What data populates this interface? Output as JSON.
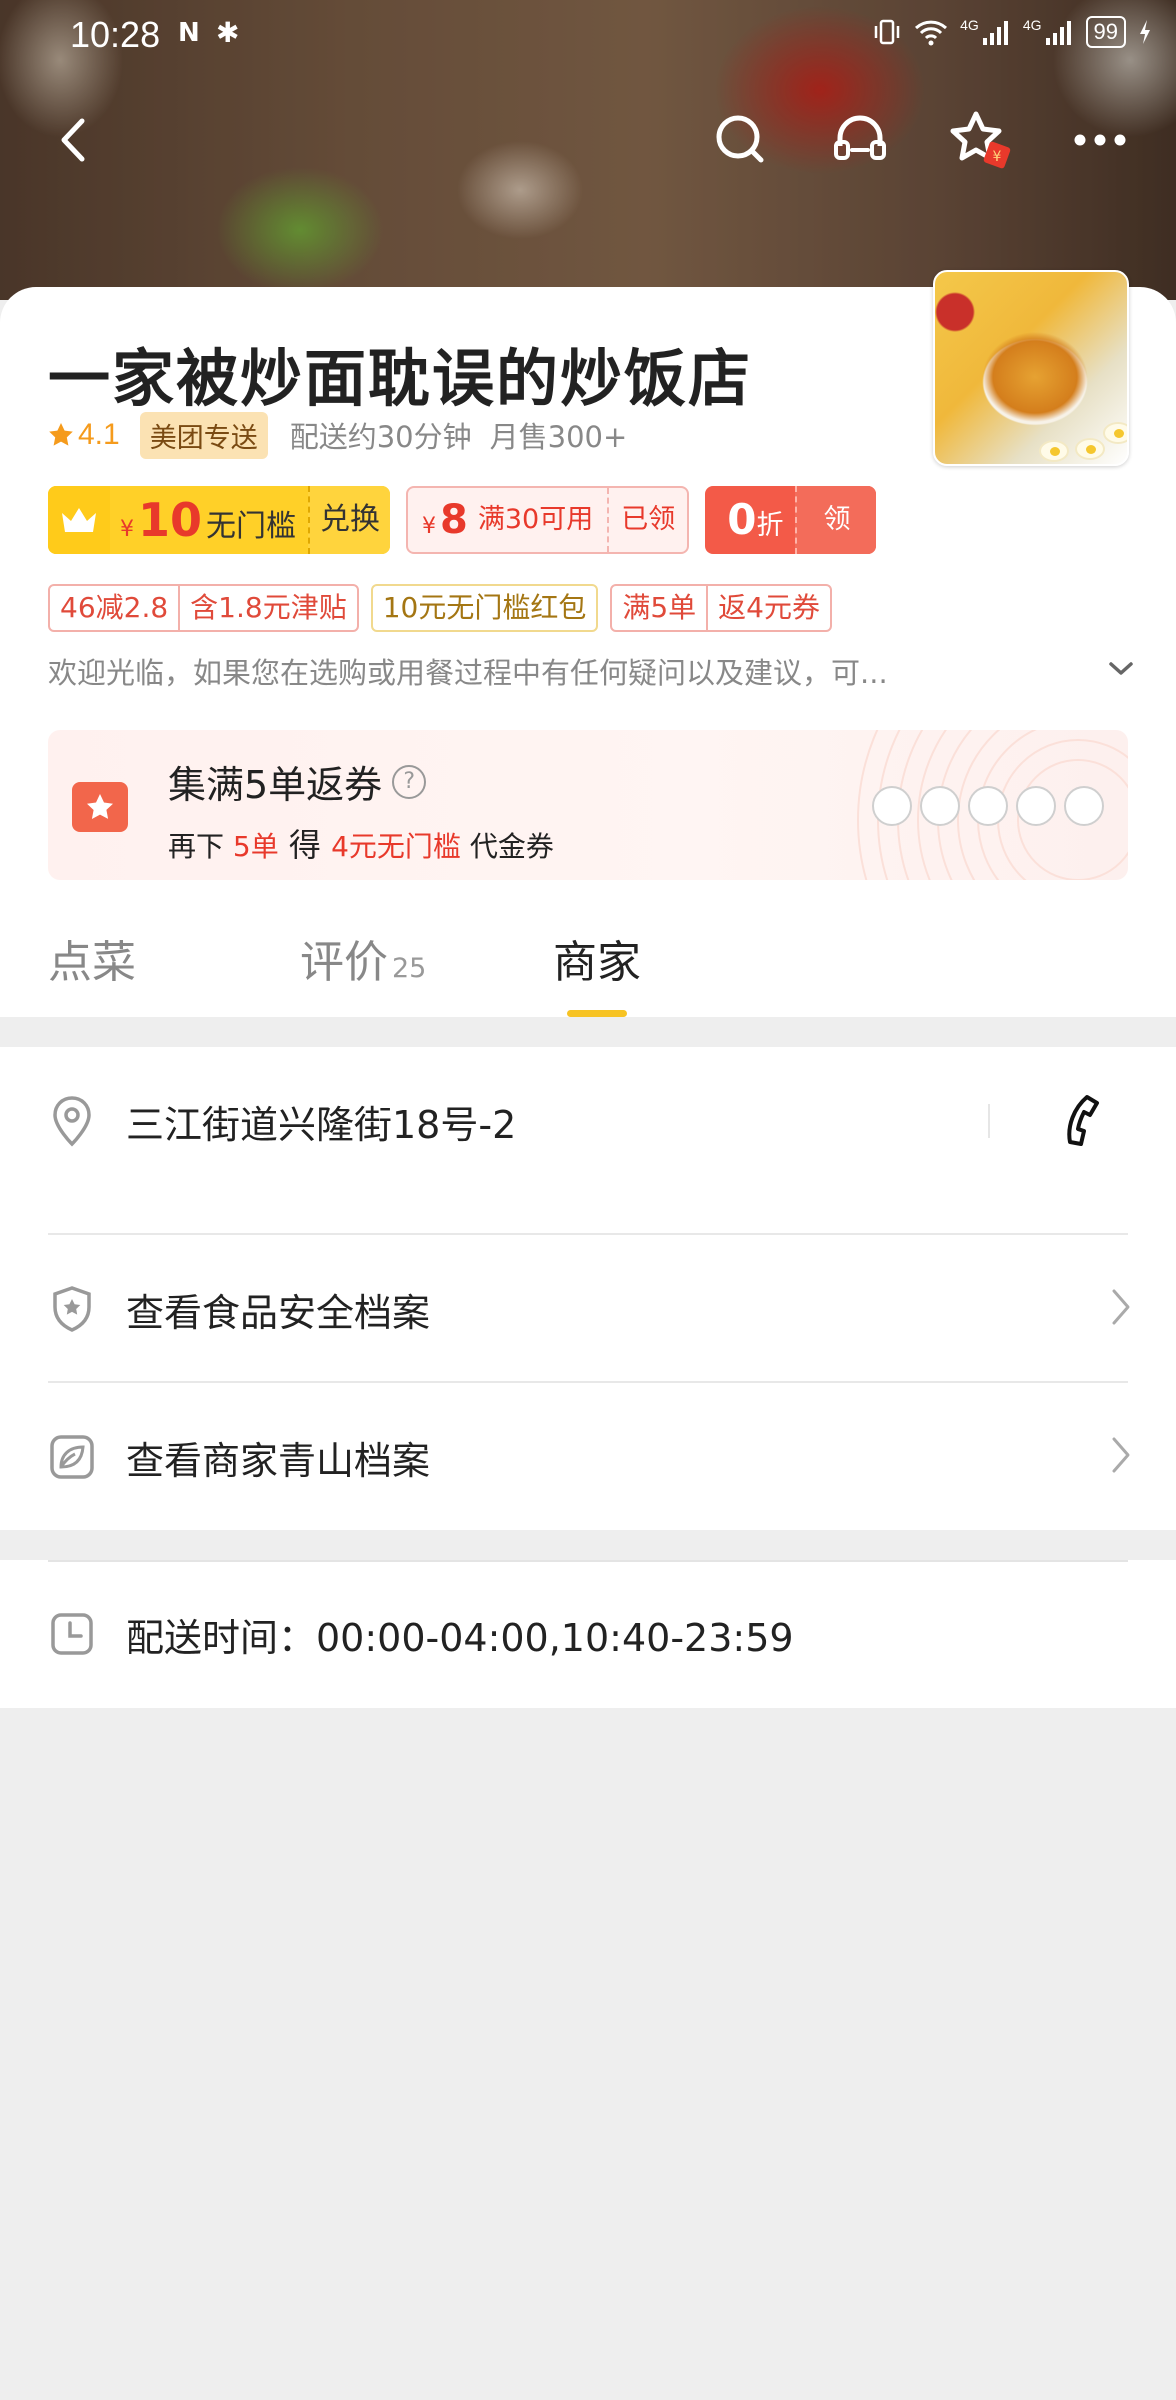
{
  "status_bar": {
    "time": "10:28",
    "nfc": "N",
    "bluetooth": "✱",
    "network": "4G",
    "network2": "4G",
    "battery": "99"
  },
  "nav": {
    "back_icon": "back-arrow-icon",
    "search_icon": "search-icon",
    "service_icon": "customer-service-icon",
    "favorite_icon": "star-icon",
    "more_icon": "more-icon"
  },
  "shop": {
    "name": "一家被炒面耽误的炒饭店",
    "rating": "4.1",
    "delivery_badge": "美团专送",
    "delivery_time": "配送约30分钟",
    "monthly_sales": "月售300+"
  },
  "coupons": {
    "gold": {
      "yen": "¥",
      "amount": "10",
      "condition": "无门槛",
      "action": "兑换"
    },
    "pink": {
      "yen": "¥",
      "amount": "8",
      "condition": "满30可用",
      "action": "已领"
    },
    "red": {
      "amount": "0",
      "unit": "折",
      "action": "领"
    }
  },
  "tags": {
    "group1": [
      "46减2.8",
      "含1.8元津贴"
    ],
    "gold": "10元无门槛红包",
    "group2": [
      "满5单",
      "返4元券"
    ]
  },
  "notice": "欢迎光临，如果您在选购或用餐过程中有任何疑问以及建议，可...",
  "collect": {
    "title": "集满5单返券",
    "help": "?",
    "sub_prefix": "再下 ",
    "sub_orders": "5单",
    "sub_mid": " 得 ",
    "sub_reward": "4元无门槛",
    "sub_suffix": " 代金券",
    "progress_filled": 0,
    "progress_total": 5
  },
  "tabs": [
    {
      "label": "点菜",
      "count": ""
    },
    {
      "label": "评价",
      "count": "25"
    },
    {
      "label": "商家",
      "count": ""
    }
  ],
  "active_tab": 2,
  "merchant": {
    "address": "三江街道兴隆街18号-2",
    "food_safety": "查看食品安全档案",
    "green_file": "查看商家青山档案",
    "delivery_hours": "配送时间：00:00-04:00,10:40-23:59"
  },
  "colors": {
    "accent_yellow": "#f7c323",
    "coupon_red": "#e8392b",
    "rating_orange": "#f59b1c",
    "page_bg": "#eeeeee"
  }
}
